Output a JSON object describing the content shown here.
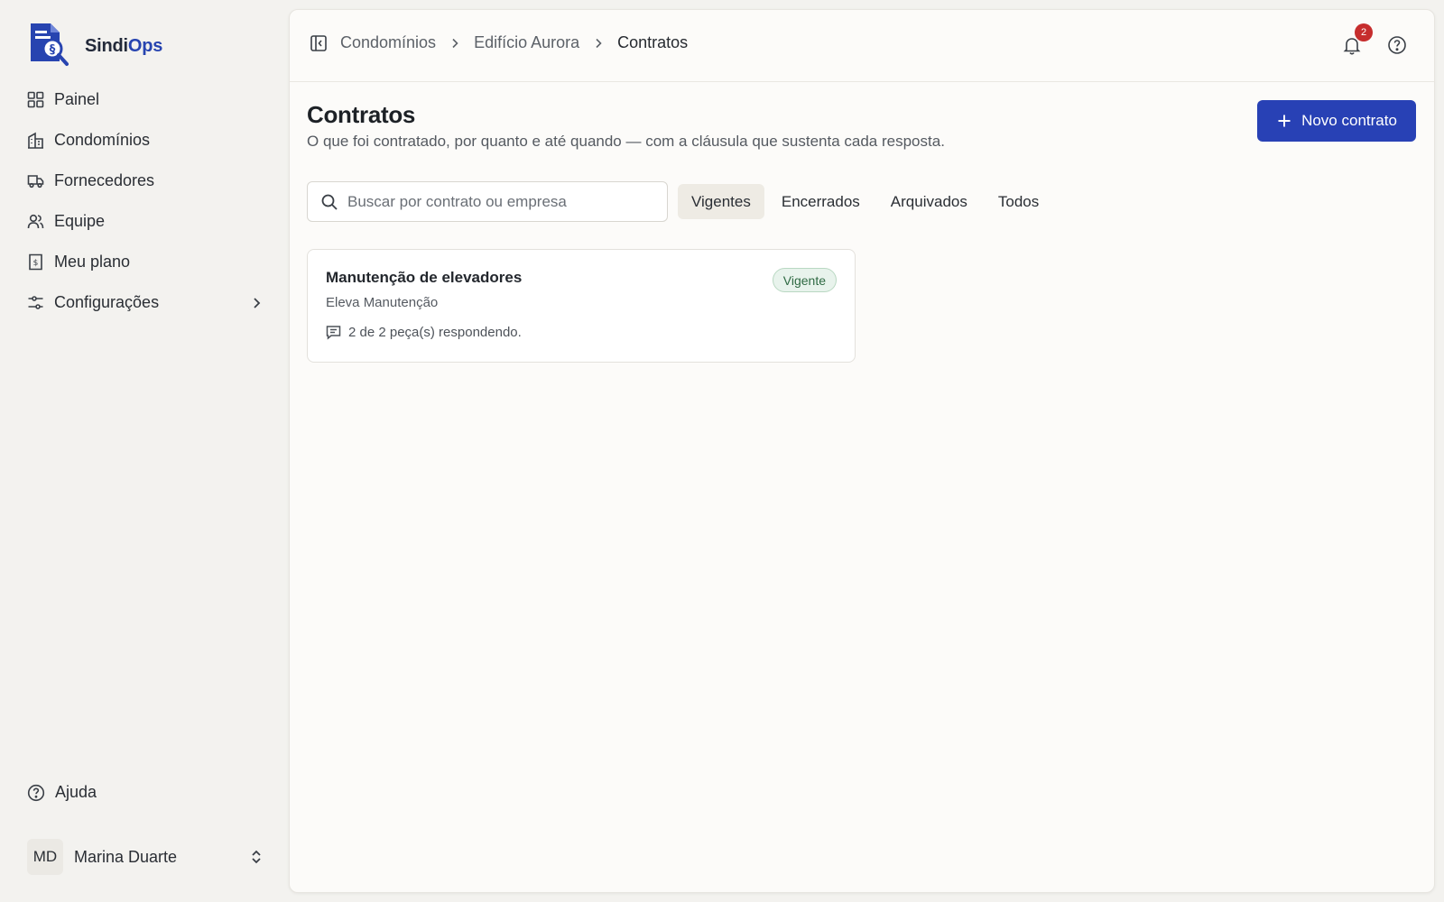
{
  "app": {
    "name_part1": "Sindi",
    "name_part2": "Ops",
    "accent_color": "#2841b5"
  },
  "sidebar": {
    "items": [
      {
        "label": "Painel",
        "icon": "grid-icon"
      },
      {
        "label": "Condomínios",
        "icon": "building-icon"
      },
      {
        "label": "Fornecedores",
        "icon": "truck-icon"
      },
      {
        "label": "Equipe",
        "icon": "users-icon"
      },
      {
        "label": "Meu plano",
        "icon": "receipt-icon"
      },
      {
        "label": "Configurações",
        "icon": "sliders-icon"
      }
    ],
    "help_label": "Ajuda",
    "user": {
      "initials": "MD",
      "name": "Marina Duarte"
    }
  },
  "header": {
    "breadcrumb": [
      "Condomínios",
      "Edifício Aurora",
      "Contratos"
    ],
    "notifications_count": "2"
  },
  "page": {
    "title": "Contratos",
    "subtitle": "O que foi contratado, por quanto e até quando — com a cláusula que sustenta cada resposta.",
    "new_button_label": "Novo contrato"
  },
  "search": {
    "placeholder": "Buscar por contrato ou empresa",
    "value": ""
  },
  "filters": {
    "tabs": [
      "Vigentes",
      "Encerrados",
      "Arquivados",
      "Todos"
    ],
    "active": "Vigentes"
  },
  "contracts": [
    {
      "title": "Manutenção de elevadores",
      "company": "Eleva Manutenção",
      "status": "Vigente",
      "status_color": "#2f6a43",
      "meta": "2 de 2 peça(s) respondendo."
    }
  ]
}
